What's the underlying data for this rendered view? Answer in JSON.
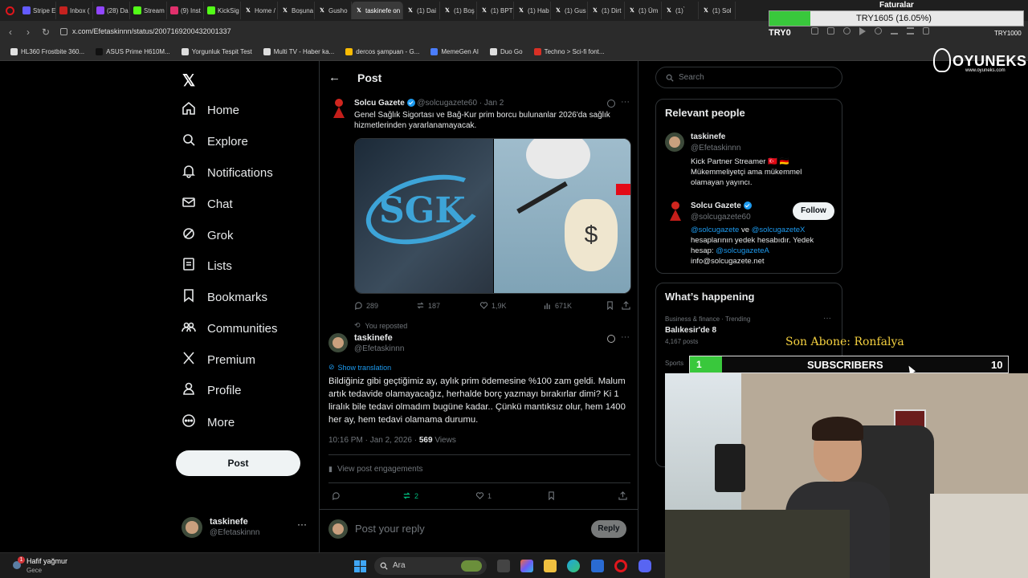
{
  "browser": {
    "tabs": [
      {
        "label": "Stripe E",
        "icon_color": "#635bff",
        "active": false
      },
      {
        "label": "Inbox (",
        "icon_color": "#c5221f",
        "active": false
      },
      {
        "label": "(28) Da",
        "icon_color": "#9146ff",
        "active": false
      },
      {
        "label": "Stream",
        "icon_color": "#53fc18",
        "active": false
      },
      {
        "label": "(9) Inst",
        "icon_color": "#e1306c",
        "active": false
      },
      {
        "label": "KickSig",
        "icon_color": "#53fc18",
        "active": false
      },
      {
        "label": "Home /",
        "icon_color": "#000000",
        "active": false
      },
      {
        "label": "Boşuna",
        "icon_color": "#000000",
        "active": false
      },
      {
        "label": "Gusho",
        "icon_color": "#000000",
        "active": false
      },
      {
        "label": "taskinefe on",
        "icon_color": "#000000",
        "active": true
      },
      {
        "label": "(1) Dai",
        "icon_color": "#000000",
        "active": false
      },
      {
        "label": "(1) Boş",
        "icon_color": "#000000",
        "active": false
      },
      {
        "label": "(1) BPT",
        "icon_color": "#000000",
        "active": false
      },
      {
        "label": "(1) Hab",
        "icon_color": "#000000",
        "active": false
      },
      {
        "label": "(1) Gus",
        "icon_color": "#000000",
        "active": false
      },
      {
        "label": "(1) Dirt",
        "icon_color": "#000000",
        "active": false
      },
      {
        "label": "(1) Üm",
        "icon_color": "#000000",
        "active": false
      },
      {
        "label": "(1) ̀",
        "icon_color": "#000000",
        "active": false
      },
      {
        "label": "(1) Sol",
        "icon_color": "#000000",
        "active": false
      }
    ],
    "url": "x.com/Efetaskinnn/status/2007169200432001337",
    "bookmarks": [
      {
        "label": "HL360 Frostbite 360...",
        "color": "#e0e0e0"
      },
      {
        "label": "ASUS Prime H610M...",
        "color": "#111111"
      },
      {
        "label": "Yorgunluk Tespit Test",
        "color": "#dddddd"
      },
      {
        "label": "Multi TV - Haber ka...",
        "color": "#dddddd"
      },
      {
        "label": "dercos şampuan - G...",
        "color": "#fbbc04"
      },
      {
        "label": "MemeGen AI",
        "color": "#4a7dff"
      },
      {
        "label": "Duo Go",
        "color": "#dddddd"
      },
      {
        "label": "Techno > Sci-fi font...",
        "color": "#d93025"
      }
    ],
    "top_right": {
      "faturalar": "Faturalar",
      "try_label": "TRY1605 (16.05%)",
      "try0": "TRY0",
      "tryR": "TRY1000"
    }
  },
  "sidebar": {
    "items": [
      {
        "label": "Home",
        "icon": "home-icon"
      },
      {
        "label": "Explore",
        "icon": "search-icon"
      },
      {
        "label": "Notifications",
        "icon": "bell-icon"
      },
      {
        "label": "Chat",
        "icon": "mail-icon"
      },
      {
        "label": "Grok",
        "icon": "grok-icon"
      },
      {
        "label": "Lists",
        "icon": "list-icon"
      },
      {
        "label": "Bookmarks",
        "icon": "bookmark-icon"
      },
      {
        "label": "Communities",
        "icon": "communities-icon"
      },
      {
        "label": "Premium",
        "icon": "x-logo-icon"
      },
      {
        "label": "Profile",
        "icon": "person-icon"
      },
      {
        "label": "More",
        "icon": "more-circle-icon"
      }
    ],
    "post_label": "Post",
    "account": {
      "name": "taskinefe",
      "handle": "@Efetaskinnn"
    }
  },
  "main": {
    "header": "Post",
    "quoted": {
      "name": "Solcu Gazete",
      "handle_date": "@solcugazete60 · Jan 2",
      "text": "Genel Sağlık Sigortası ve Bağ-Kur prim borcu bulunanlar 2026'da sağlık hizmetlerinden yararlanamayacak.",
      "image_text": "SGK",
      "stats": {
        "replies": "289",
        "reposts": "187",
        "likes": "1,9K",
        "views": "671K"
      }
    },
    "repost_note": "You reposted",
    "post": {
      "name": "taskinefe",
      "handle": "@Efetaskinnn",
      "show_translation": "Show translation",
      "text": "Bildiğiniz gibi geçtiğimiz ay, aylık prim ödemesine %100 zam geldi. Malum artık tedavide olamayacağız, herhalde borç yazmayı bırakırlar dimi? Ki 1 liralık bile tedavi olmadım bugüne kadar.. Çünkü mantıksız olur, hem 1400 her ay, hem tedavi olamama durumu.",
      "time": "10:16 PM · Jan 2, 2026 ·",
      "views_count": "569",
      "views_label": "Views",
      "engagements": "View post engagements",
      "reposts": "2",
      "likes": "1"
    },
    "reply_placeholder": "Post your reply",
    "reply_button": "Reply"
  },
  "right": {
    "search_placeholder": "Search",
    "relevant_title": "Relevant people",
    "people": [
      {
        "name": "taskinefe",
        "handle": "@Efetaskinnn",
        "bio": "Kick Partner Streamer 🇹🇷 🇩🇪 Mükemmeliyetçi ama mükemmel olamayan yayıncı."
      },
      {
        "name": "Solcu Gazete",
        "handle": "@solcugazete60",
        "bio_link1": "@solcugazete",
        "bio_mid": "ve",
        "bio_link2": "@solcugazeteX",
        "bio_rest": "hesaplarının yedek hesabıdır. Yedek hesap:",
        "bio_link3": "@solcugazeteA",
        "bio_email": "info@solcugazete.net",
        "follow": "Follow"
      }
    ],
    "happening_title": "What’s happening",
    "trend": {
      "category": "Business & finance · Trending",
      "topic": "Balıkesir'de 8",
      "posts": "4,167 posts",
      "next_category": "Sports"
    }
  },
  "overlay": {
    "brand": "OYUNEKS",
    "brand_sub": "www.oyuneks.com",
    "son_abone": "Son Abone: Ronfalya",
    "subs_left": "1",
    "subs_title": "SUBSCRIBERS",
    "subs_right": "10"
  },
  "taskbar": {
    "weather": "Hafif yağmur",
    "weather_sub": "Gece",
    "search": "Ara",
    "badge": "1"
  }
}
